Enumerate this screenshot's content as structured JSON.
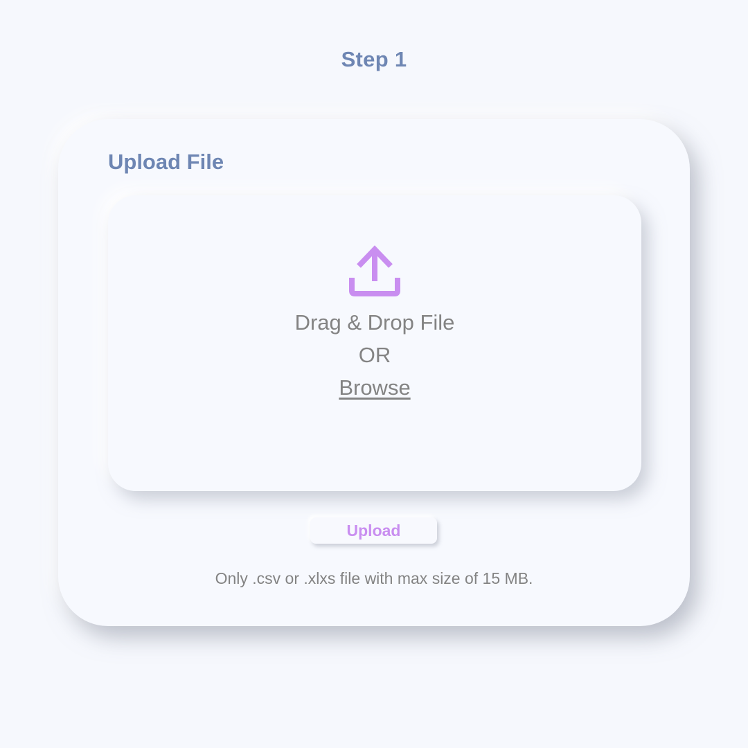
{
  "page": {
    "step_title": "Step 1"
  },
  "card": {
    "title": "Upload File",
    "dropzone": {
      "icon": "upload-icon",
      "drag_text": "Drag & Drop File",
      "or_text": "OR",
      "browse_label": "Browse"
    },
    "upload_button_label": "Upload",
    "note": "Only  .csv or .xlxs file with max size of 15 MB."
  },
  "colors": {
    "background": "#f6f8fd",
    "heading": "#6e86b3",
    "accent": "#c98ef0",
    "text": "#838383"
  }
}
